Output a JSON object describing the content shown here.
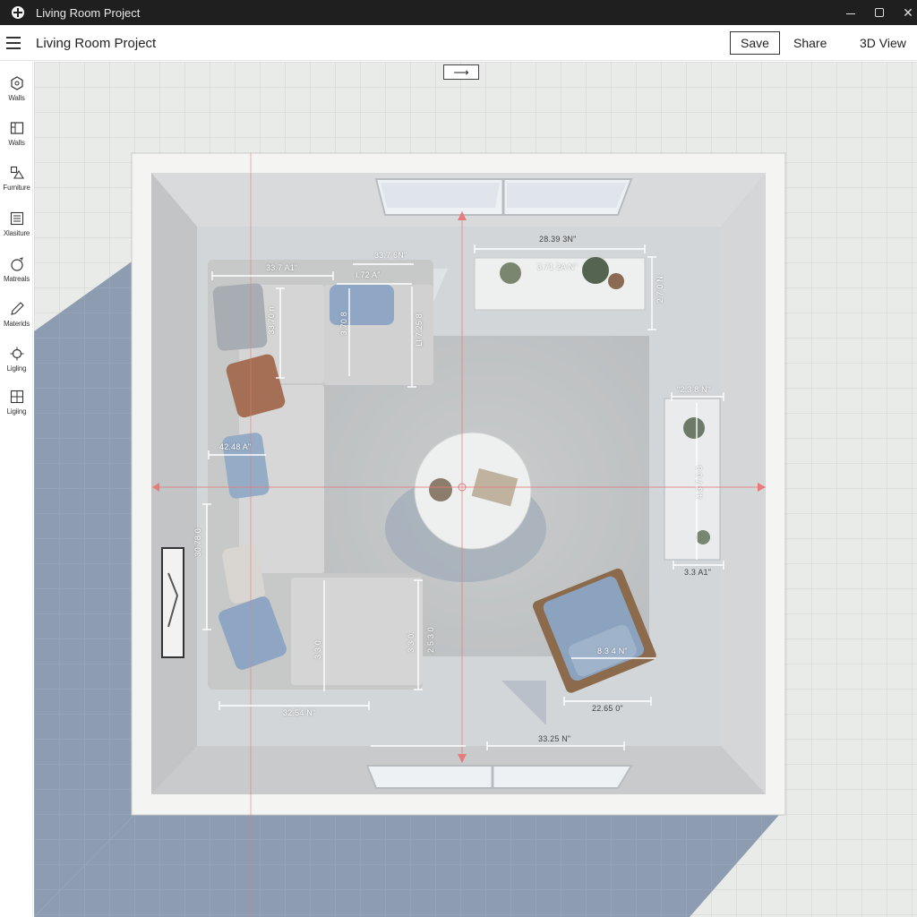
{
  "window": {
    "title": "Living Room Project"
  },
  "toolbar": {
    "project_title": "Living Room Project",
    "save_label": "Save",
    "share_label": "Share",
    "view3d_label": "3D View"
  },
  "sidebar": {
    "items": [
      {
        "label": "Walls",
        "icon": "hexagon-icon"
      },
      {
        "label": "Walls",
        "icon": "wall-panel-icon"
      },
      {
        "label": "Furniture",
        "icon": "furniture-shapes-icon"
      },
      {
        "label": "Xlasiture",
        "icon": "list-icon"
      },
      {
        "label": "Matreals",
        "icon": "material-sphere-icon"
      },
      {
        "label": "Materids",
        "icon": "pencil-icon"
      },
      {
        "label": "Ligling",
        "icon": "bulb-icon"
      },
      {
        "label": "Ligiing",
        "icon": "grid-window-icon"
      }
    ]
  },
  "canvas": {
    "direction_toggle": "⟶",
    "dimensions": {
      "sofa_top": "33.7 A1\"",
      "sofa_top_right": "33.7 6N\"",
      "sofa_top_inner": "I.72 A\"",
      "sofa_depth_left": "33.70 n",
      "sofa_depth_mid": "3.70 8",
      "sofa_depth_right": "LI 7.25 8",
      "sofa_cushion": "42.48 A\"",
      "sofa_side": "30.78 0",
      "sofa_bottom": "32.54 N\"",
      "sofa_bottom_inner": "3 3 0",
      "sofa_bottom_right": "3 3 0.",
      "sofa_bottom_right_b": "2 5 3 0",
      "console_width": "28.39 3N\"",
      "console_inner": "3.71 2A N\"",
      "console_depth": "2.7 0 N",
      "bench_width": "\"2.3 8 N\"",
      "bench_length": "4.3 7 0 8",
      "bench_bottom": "3.3 A1\"",
      "chair_width": "8.3 4 N\"",
      "chair_bottom": "22.65 0\"",
      "floor_bottom": "33.25 N\""
    }
  },
  "colors": {
    "grid_bg": "#e9ebe8",
    "shadow": "#8d9cb2",
    "wall_frame": "#f4f4f2",
    "floor": "#d3d6d9",
    "sofa": "#cfd0cf",
    "rug": "#c3c5c6",
    "accent_cushion": "#9fb5cf",
    "guide_line": "#e57b7b"
  }
}
